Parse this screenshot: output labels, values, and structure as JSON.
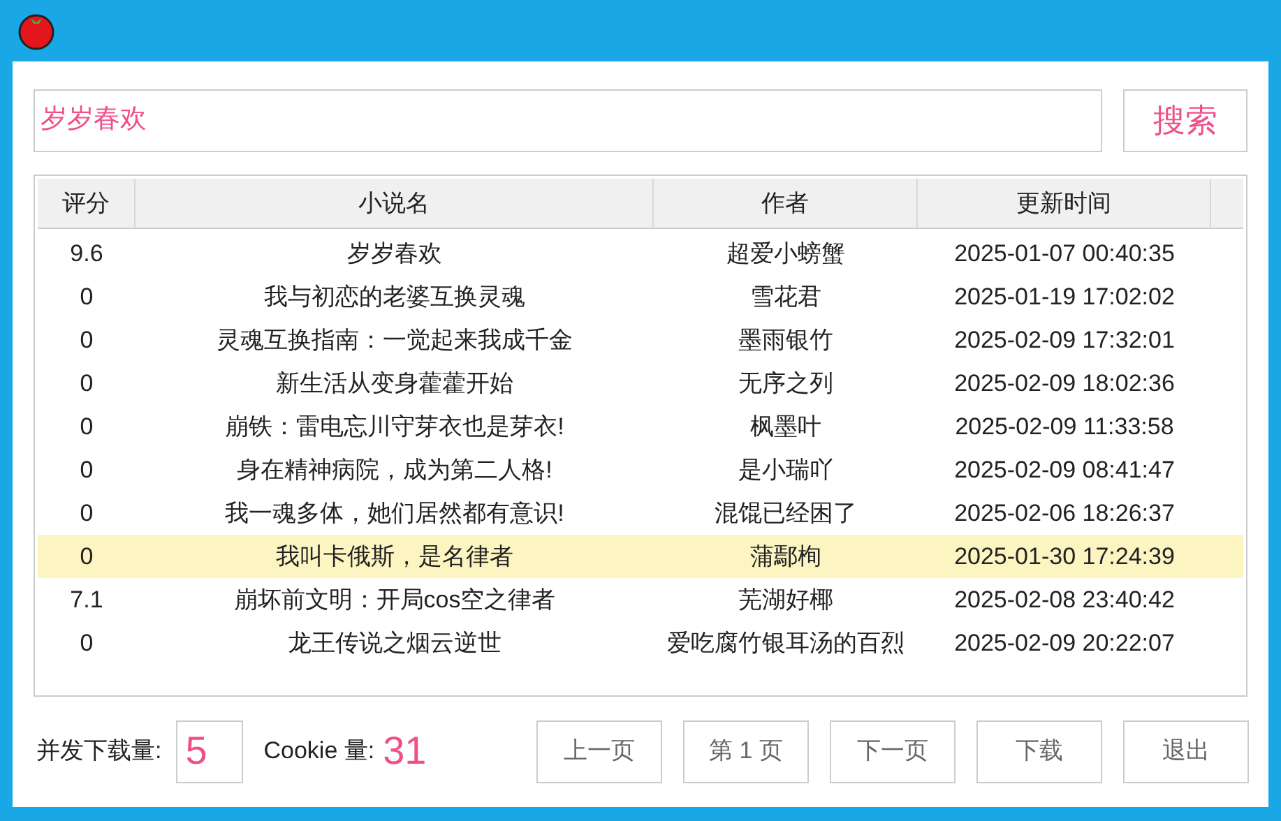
{
  "search": {
    "value": "岁岁春欢",
    "button": "搜索"
  },
  "table": {
    "columns": [
      "评分",
      "小说名",
      "作者",
      "更新时间"
    ],
    "rows": [
      {
        "cells": [
          "9.6",
          "岁岁春欢",
          "超爱小螃蟹",
          "2025-01-07 00:40:35"
        ],
        "selected": false
      },
      {
        "cells": [
          "0",
          "我与初恋的老婆互换灵魂",
          "雪花君",
          "2025-01-19 17:02:02"
        ],
        "selected": false
      },
      {
        "cells": [
          "0",
          "灵魂互换指南：一觉起来我成千金",
          "墨雨银竹",
          "2025-02-09 17:32:01"
        ],
        "selected": false
      },
      {
        "cells": [
          "0",
          "新生活从变身藿藿开始",
          "无序之列",
          "2025-02-09 18:02:36"
        ],
        "selected": false
      },
      {
        "cells": [
          "0",
          "崩铁：雷电忘川守芽衣也是芽衣!",
          "枫墨叶",
          "2025-02-09 11:33:58"
        ],
        "selected": false
      },
      {
        "cells": [
          "0",
          "身在精神病院，成为第二人格!",
          "是小瑞吖",
          "2025-02-09 08:41:47"
        ],
        "selected": false
      },
      {
        "cells": [
          "0",
          "我一魂多体，她们居然都有意识!",
          "混馄已经困了",
          "2025-02-06 18:26:37"
        ],
        "selected": false
      },
      {
        "cells": [
          "0",
          "我叫卡俄斯，是名律者",
          "蒲鄢栒",
          "2025-01-30 17:24:39"
        ],
        "selected": true
      },
      {
        "cells": [
          "7.1",
          "崩坏前文明：开局cos空之律者",
          "芜湖好椰",
          "2025-02-08 23:40:42"
        ],
        "selected": false
      },
      {
        "cells": [
          "0",
          "龙王传说之烟云逆世",
          "爱吃腐竹银耳汤的百烈",
          "2025-02-09 20:22:07"
        ],
        "selected": false
      }
    ]
  },
  "footer": {
    "concurrency_label": "并发下载量:",
    "concurrency_value": "5",
    "cookie_label": "Cookie 量:",
    "cookie_value": "31",
    "buttons": [
      "上一页",
      "第 1 页",
      "下一页",
      "下载",
      "退出"
    ]
  }
}
